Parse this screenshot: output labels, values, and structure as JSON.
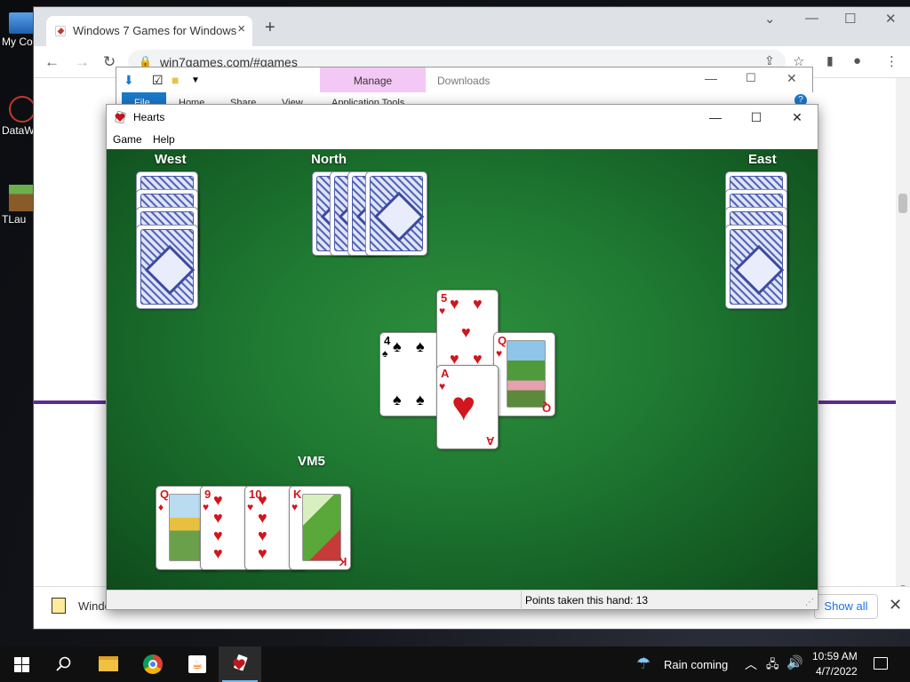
{
  "desktop": {
    "icons": [
      {
        "label": "My Co"
      },
      {
        "label": "DataW"
      },
      {
        "label": "TLau"
      }
    ]
  },
  "chrome": {
    "tab_title": "Windows 7 Games for Windows",
    "tab_close": "×",
    "new_tab": "+",
    "url": "win7games.com/#games",
    "download_item": "Windo",
    "show_all": "Show all",
    "close_download_bar": "✕"
  },
  "explorer": {
    "manage_label": "Manage",
    "downloads_label": "Downloads",
    "ribbon_tabs": [
      "File",
      "Home",
      "Share",
      "View",
      "Application Tools"
    ]
  },
  "hearts": {
    "title": "Hearts",
    "menu": [
      "Game",
      "Help"
    ],
    "players": {
      "west": "West",
      "north": "North",
      "east": "East",
      "south": "VM5"
    },
    "status": "Points taken this hand: 13",
    "trick": [
      {
        "rank": "4",
        "suit": "♠",
        "color": "#000000",
        "player": "west"
      },
      {
        "rank": "5",
        "suit": "♥",
        "color": "#d0161e",
        "player": "north"
      },
      {
        "rank": "Q",
        "suit": "♥",
        "color": "#d0161e",
        "player": "east"
      },
      {
        "rank": "A",
        "suit": "♥",
        "color": "#d0161e",
        "player": "south"
      }
    ],
    "hand": [
      {
        "rank": "Q",
        "suit": "♦",
        "color": "#d0161e"
      },
      {
        "rank": "9",
        "suit": "♥",
        "color": "#d0161e"
      },
      {
        "rank": "10",
        "suit": "♥",
        "color": "#d0161e"
      },
      {
        "rank": "K",
        "suit": "♥",
        "color": "#d0161e"
      }
    ]
  },
  "taskbar": {
    "weather": "Rain coming",
    "time": "10:59 AM",
    "date": "4/7/2022"
  }
}
